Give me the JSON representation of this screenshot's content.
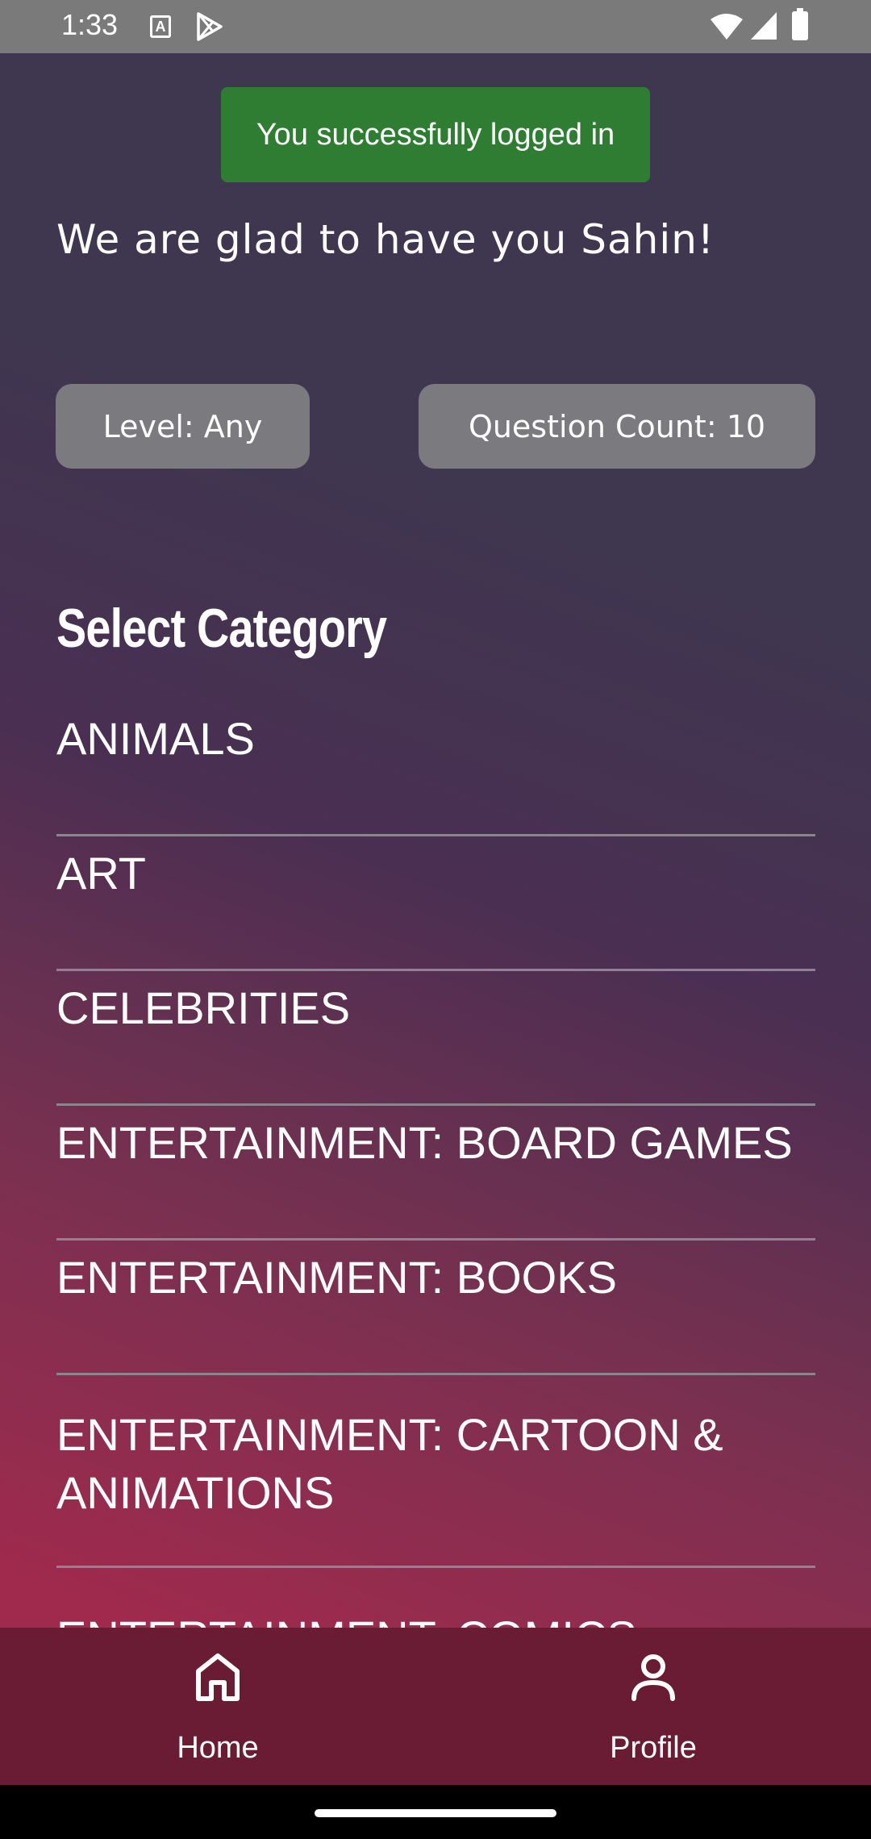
{
  "status_bar": {
    "time": "1:33",
    "a_icon_label": "A"
  },
  "toast": {
    "message": "You successfully logged in"
  },
  "greeting": "We are glad to have you Sahin!",
  "settings": {
    "level_label": "Level: Any",
    "count_label": "Question Count: 10"
  },
  "category_section": {
    "title": "Select Category",
    "items": [
      {
        "label": "ANIMALS"
      },
      {
        "label": "ART"
      },
      {
        "label": "CELEBRITIES"
      },
      {
        "label": "ENTERTAINMENT: BOARD GAMES"
      },
      {
        "label": "ENTERTAINMENT: BOOKS"
      },
      {
        "label": "ENTERTAINMENT: CARTOON & ANIMATIONS"
      },
      {
        "label": "ENTERTAINMENT: COMICS"
      }
    ]
  },
  "bottom_nav": {
    "home_label": "Home",
    "home_icon": "home-icon",
    "profile_label": "Profile",
    "profile_icon": "person-icon"
  },
  "colors": {
    "toast_bg": "#2e7d32",
    "pill_bg": "#7b7a7f",
    "nav_bg": "#691c33",
    "gradient_top": "#3f3650",
    "gradient_bottom": "#a02a4e"
  }
}
